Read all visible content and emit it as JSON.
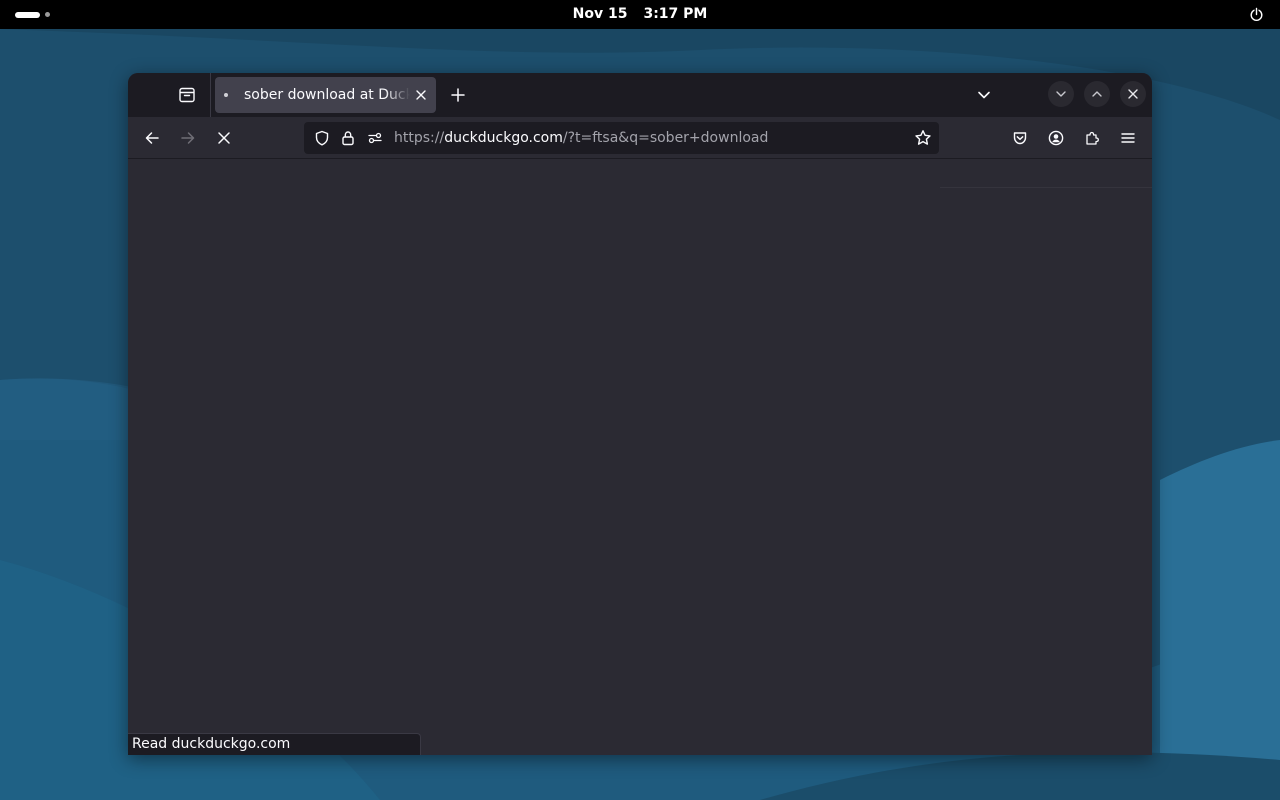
{
  "desktop": {
    "topbar": {
      "date": "Nov 15",
      "time": "3:17 PM",
      "activities_icon": "workspace-indicator-icon",
      "power_icon": "power-icon"
    },
    "colors": {
      "wallpaper_dark": "#1b4661",
      "wallpaper_light": "#2a6f95",
      "topbar": "#000000"
    }
  },
  "browser": {
    "tab": {
      "title": "sober download at DuckDuckGo",
      "close_icon": "close-icon"
    },
    "toolbar": {
      "url_prefix": "https://",
      "url_host": "duckduckgo.com",
      "url_path": "/?t=ftsa&q=sober+download"
    },
    "status_text": "Read duckduckgo.com",
    "colors": {
      "tabbar": "#1c1b22",
      "toolbar": "#2b2a33",
      "tab_selected": "#42414d",
      "text": "#fbfbfe"
    }
  }
}
